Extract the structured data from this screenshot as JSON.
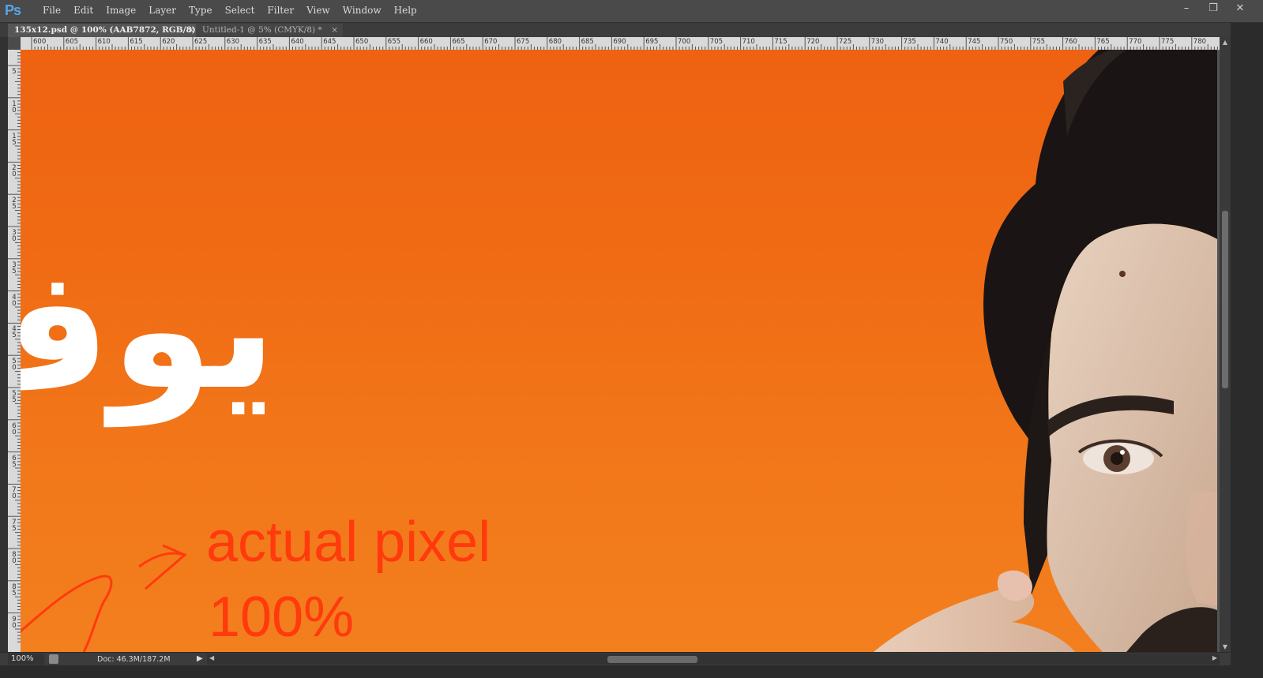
{
  "app": {
    "logo": "Ps"
  },
  "menu": [
    "File",
    "Edit",
    "Image",
    "Layer",
    "Type",
    "Select",
    "Filter",
    "View",
    "Window",
    "Help"
  ],
  "window_controls": {
    "minimize": "–",
    "restore": "❐",
    "close": "✕"
  },
  "tabs": [
    {
      "label": "135x12.psd @ 100% (AAB7872, RGB/8) *",
      "close": "×",
      "active": true
    },
    {
      "label": "Untitled-1 @ 5% (CMYK/8) *",
      "close": "×",
      "active": false
    }
  ],
  "ruler_horizontal": [
    "600",
    "605",
    "610",
    "615",
    "620",
    "625",
    "630",
    "635",
    "640",
    "645",
    "650",
    "655",
    "660",
    "665",
    "670",
    "675",
    "680",
    "685",
    "690",
    "695",
    "700",
    "705",
    "710",
    "715",
    "720",
    "725",
    "730",
    "735",
    "740",
    "745",
    "750",
    "755",
    "760",
    "765",
    "770",
    "775",
    "780"
  ],
  "ruler_vertical": [
    "5",
    "10",
    "15",
    "20",
    "25",
    "30",
    "35",
    "40",
    "45",
    "50",
    "55",
    "60",
    "65",
    "70",
    "75",
    "80",
    "85",
    "90"
  ],
  "canvas": {
    "arabic_text": "يوف",
    "annotation_line1": "actual pixel",
    "annotation_line2": "100%",
    "annotation_color": "#ff3a0d",
    "background_color": "#f06b14"
  },
  "status": {
    "zoom": "100%",
    "doc_info": "Doc: 46.3M/187.2M"
  }
}
